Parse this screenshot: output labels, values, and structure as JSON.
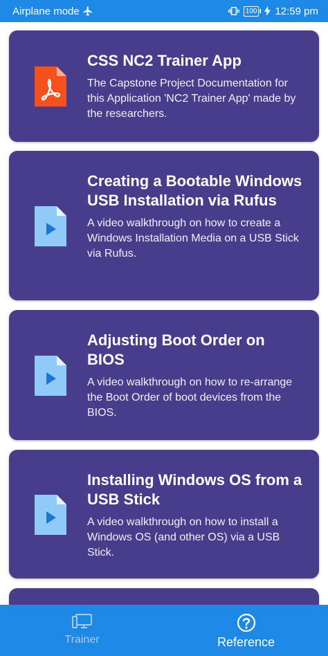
{
  "status_bar": {
    "mode": "Airplane mode",
    "battery": "100",
    "time": "12:59 pm"
  },
  "cards": [
    {
      "icon": "pdf-file-icon",
      "title": "CSS NC2 Trainer App",
      "description": "The Capstone Project Documentation for this Application 'NC2 Trainer App' made by the researchers."
    },
    {
      "icon": "video-file-icon",
      "title": "Creating a Bootable Windows USB Installation via Rufus",
      "description": "A video walkthrough on how to create a Windows Installation Media on a USB Stick via Rufus."
    },
    {
      "icon": "video-file-icon",
      "title": "Adjusting Boot Order on BIOS",
      "description": "A video walkthrough on how to re-arrange the Boot Order of boot devices from the BIOS."
    },
    {
      "icon": "video-file-icon",
      "title": "Installing Windows OS from a USB Stick",
      "description": "A video walkthrough on how to install a Windows OS (and other OS) via a USB Stick."
    }
  ],
  "bottom_nav": {
    "items": [
      {
        "label": "Trainer",
        "icon": "computer-icon",
        "active": false
      },
      {
        "label": "Reference",
        "icon": "help-icon",
        "active": true
      }
    ]
  },
  "colors": {
    "status_bar": "#1e88e5",
    "card_background": "#483d8b",
    "pdf_icon": "#f4511e",
    "video_icon": "#90caf9",
    "video_play": "#1976d2"
  }
}
